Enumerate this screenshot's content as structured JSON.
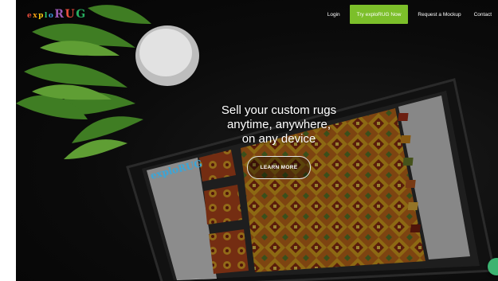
{
  "brand": {
    "logo_letters": [
      {
        "ch": "e",
        "color": "#e74c3c",
        "size": "small"
      },
      {
        "ch": "x",
        "color": "#f39c12",
        "size": "small"
      },
      {
        "ch": "p",
        "color": "#f1c40f",
        "size": "small"
      },
      {
        "ch": "l",
        "color": "#2ecc71",
        "size": "small"
      },
      {
        "ch": "o",
        "color": "#3498db",
        "size": "small"
      },
      {
        "ch": "R",
        "color": "#9b59b6",
        "size": "big"
      },
      {
        "ch": "U",
        "color": "#e74c3c",
        "size": "big"
      },
      {
        "ch": "G",
        "color": "#27ae60",
        "size": "big"
      }
    ]
  },
  "nav": {
    "items": [
      {
        "label": "Login",
        "name": "nav-login",
        "cta": false
      },
      {
        "label": "Try exploRUG Now",
        "name": "nav-try-explorug-now",
        "cta": true
      },
      {
        "label": "Request a Mockup",
        "name": "nav-request-mockup",
        "cta": false
      },
      {
        "label": "Contact",
        "name": "nav-contact",
        "cta": false
      }
    ],
    "cta_color": "#7cbf2a"
  },
  "hero": {
    "lines": [
      "Sell your custom rugs",
      "anytime, anywhere,",
      "on any device"
    ],
    "button_label": "LEARN MORE"
  },
  "chat_widget": {
    "icon": "chat-icon",
    "color": "#3cb371"
  }
}
